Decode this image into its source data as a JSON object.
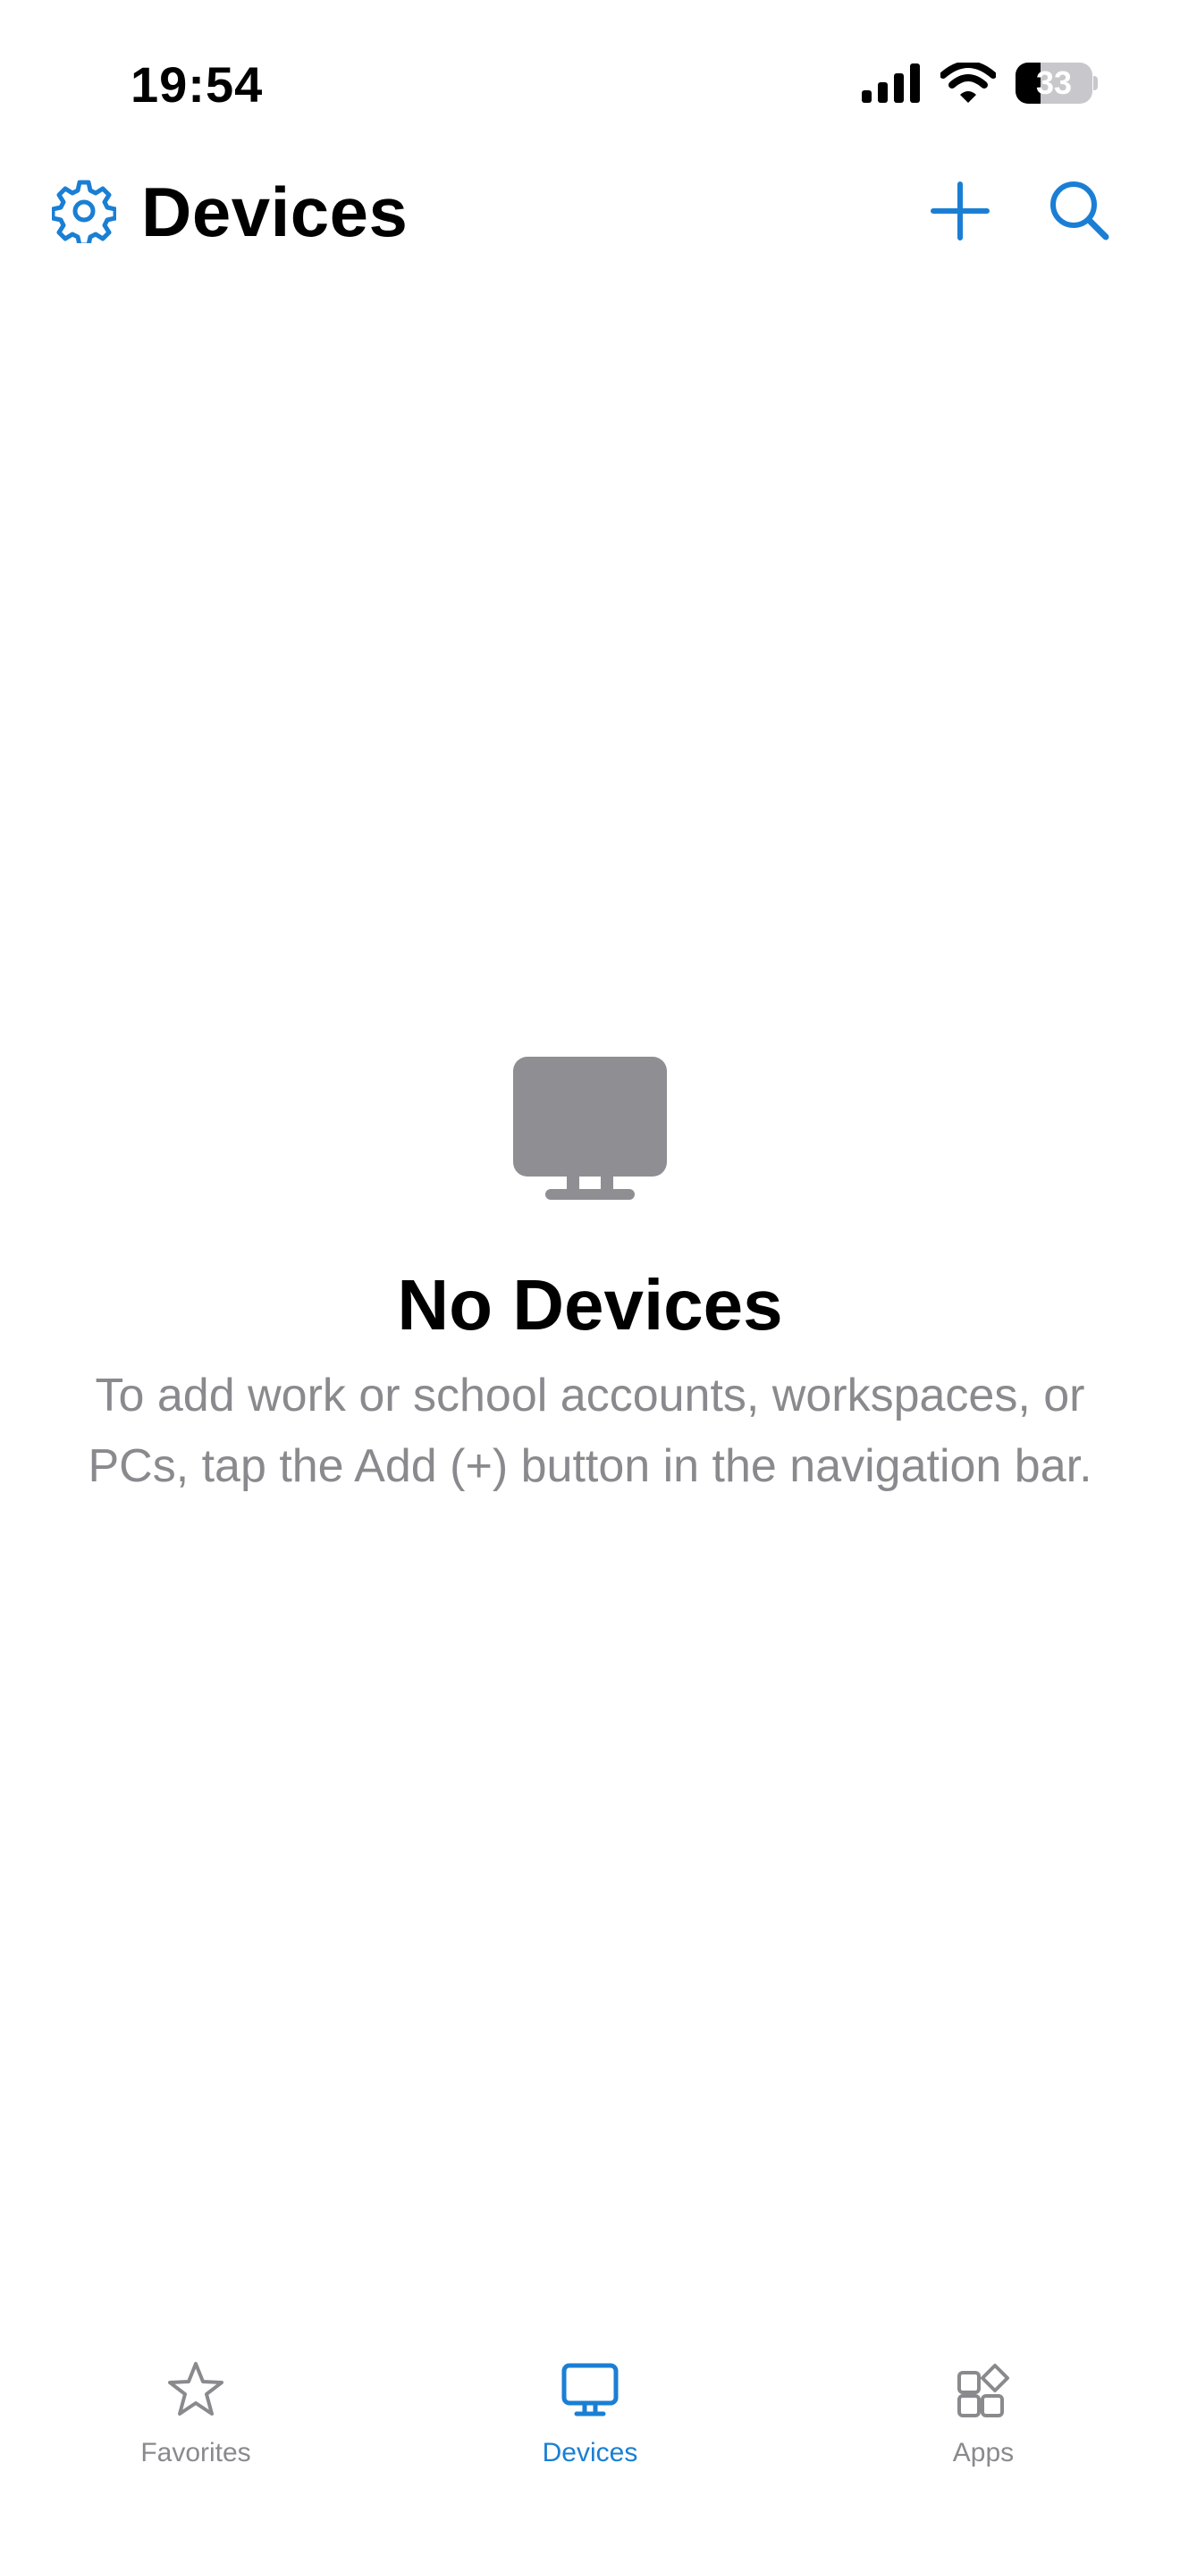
{
  "status_bar": {
    "time": "19:54",
    "battery_level": "33",
    "icons": [
      "cellular-signal-icon",
      "wifi-icon",
      "battery-icon"
    ]
  },
  "nav_bar": {
    "title": "Devices",
    "left_icon": "gear-icon",
    "right_icons": [
      "plus-icon",
      "search-icon"
    ]
  },
  "empty_state": {
    "icon": "monitor-icon",
    "title": "No Devices",
    "message": "To add work or school accounts, workspaces, or PCs, tap the Add (+) button in the navigation bar."
  },
  "tab_bar": {
    "selected": "Devices",
    "tabs": [
      {
        "label": "Favorites",
        "icon": "star-icon"
      },
      {
        "label": "Devices",
        "icon": "monitor-icon"
      },
      {
        "label": "Apps",
        "icon": "apps-icon"
      }
    ]
  },
  "colors": {
    "accent": "#1a7fd4",
    "secondary_text": "#8a8a8e",
    "empty_icon": "#8e8e93",
    "background": "#ffffff"
  }
}
